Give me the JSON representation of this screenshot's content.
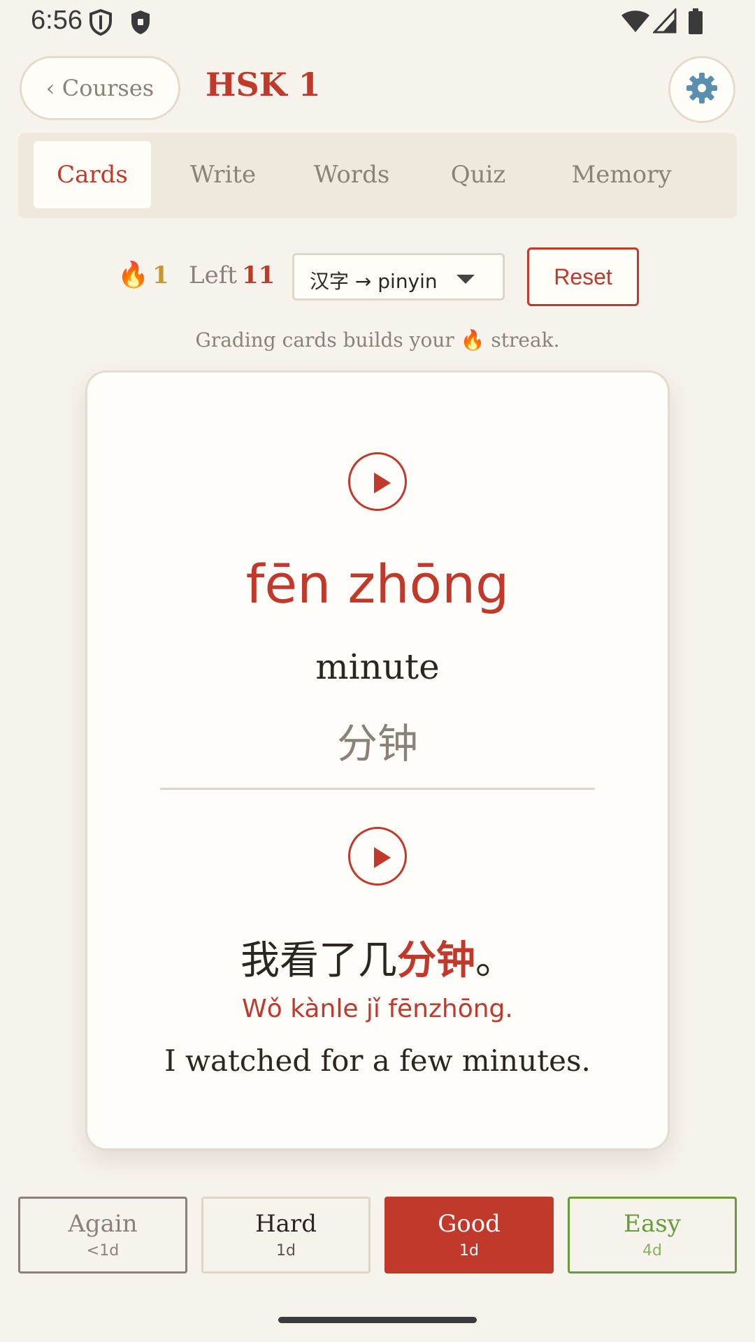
{
  "status_bar": {
    "time": "6:56"
  },
  "header": {
    "back_label": "‹ Courses",
    "title": "HSK 1",
    "settings_icon": "gear-icon"
  },
  "tabs": [
    {
      "label": "Cards",
      "active": true
    },
    {
      "label": "Write",
      "active": false
    },
    {
      "label": "Words",
      "active": false
    },
    {
      "label": "Quiz",
      "active": false
    },
    {
      "label": "Memory",
      "active": false
    }
  ],
  "controls": {
    "streak_icon": "🔥",
    "streak_count": "1",
    "left_label": "Left",
    "left_count": "11",
    "mode_selected": "汉字 → pinyin",
    "reset_label": "Reset"
  },
  "hint": "Grading cards builds your 🔥 streak.",
  "card": {
    "pinyin": "fēn zhōng",
    "meaning": "minute",
    "hanzi": "分钟",
    "example": {
      "before": "我看了几",
      "highlight": "分钟",
      "after": "。",
      "pinyin": "Wǒ kànle jǐ fēnzhōng.",
      "english": "I watched for a few minutes."
    }
  },
  "grades": [
    {
      "label": "Again",
      "interval": "<1d"
    },
    {
      "label": "Hard",
      "interval": "1d"
    },
    {
      "label": "Good",
      "interval": "1d"
    },
    {
      "label": "Easy",
      "interval": "4d"
    }
  ],
  "colors": {
    "accent": "#c0392b",
    "background": "#f6f3ec",
    "streak": "#c8952e",
    "easy": "#6a9a3a"
  }
}
